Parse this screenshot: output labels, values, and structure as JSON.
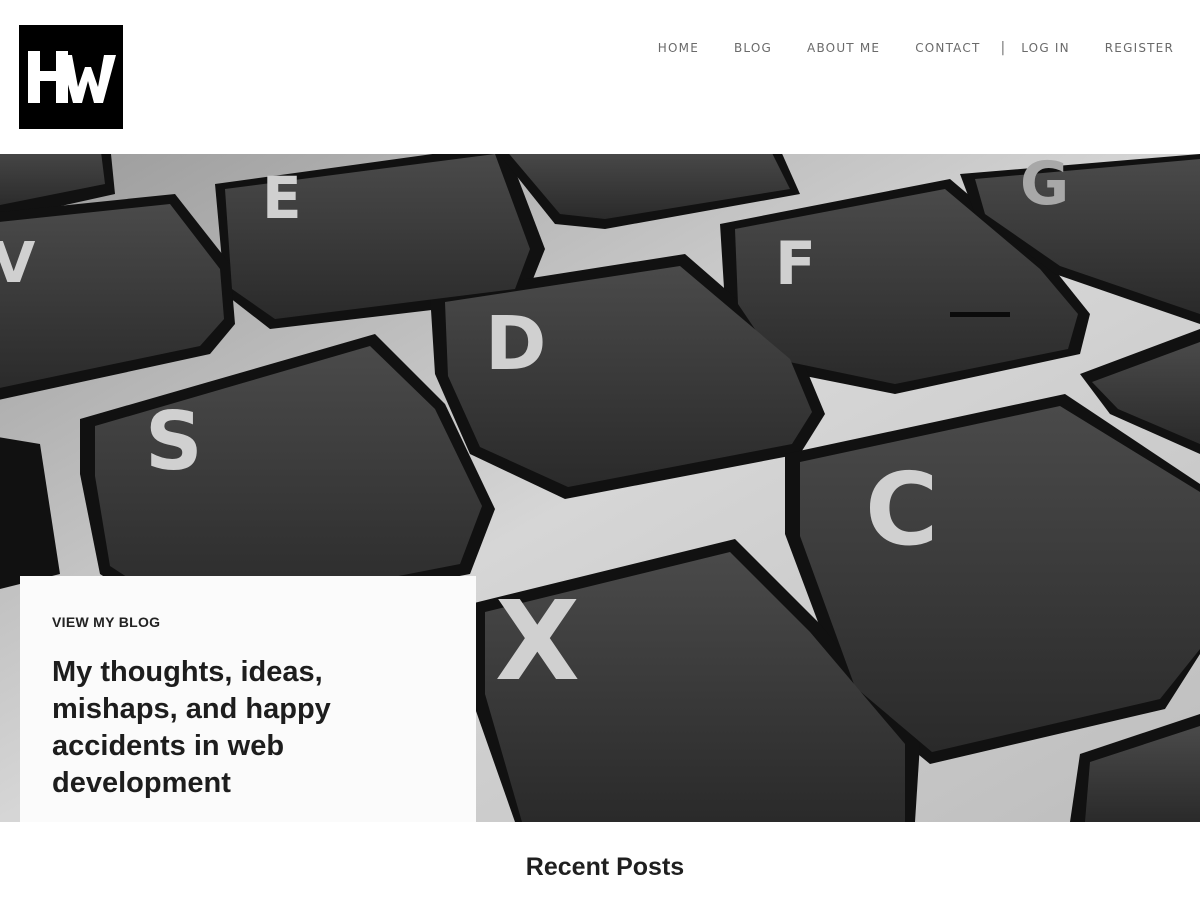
{
  "header": {
    "logo": {
      "icon": "hw-monogram-logo",
      "text": "HW"
    },
    "nav": {
      "home": "HOME",
      "blog": "BLOG",
      "about": "ABOUT ME",
      "contact": "CONTACT",
      "separator": "|",
      "login": "LOG IN",
      "register": "REGISTER"
    }
  },
  "hero": {
    "image": "keyboard-closeup-grayscale",
    "key_letters": [
      "E",
      "V",
      "F",
      "G",
      "D",
      "S",
      "C",
      "X"
    ],
    "card": {
      "eyebrow": "VIEW MY BLOG",
      "title": "My thoughts, ideas, mishaps, and happy accidents in web development"
    }
  },
  "recent_posts": {
    "title": "Recent Posts"
  }
}
